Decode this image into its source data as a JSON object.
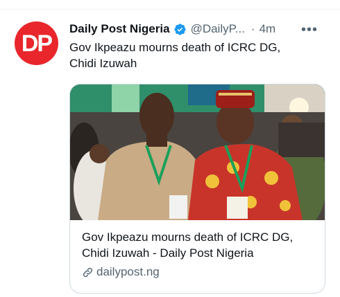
{
  "tweet": {
    "avatar_text": "DP",
    "author_name": "Daily Post Nigeria",
    "handle": "@DailyP...",
    "separator": "·",
    "time": "4m",
    "more_label": "•••",
    "text_line1": "Gov Ikpeazu mourns death of ICRC DG,",
    "text_line2": "Chidi Izuwah"
  },
  "card": {
    "title_line1": "Gov Ikpeazu mourns death of ICRC DG,",
    "title_line2": "Chidi Izuwah - Daily Post Nigeria",
    "domain": "dailypost.ng"
  },
  "colors": {
    "avatar_bg": "#e8262b",
    "verified": "#1d9bf0",
    "secondary_text": "#536471"
  },
  "icons": [
    "verified-badge-icon",
    "more-options-icon",
    "link-icon"
  ]
}
